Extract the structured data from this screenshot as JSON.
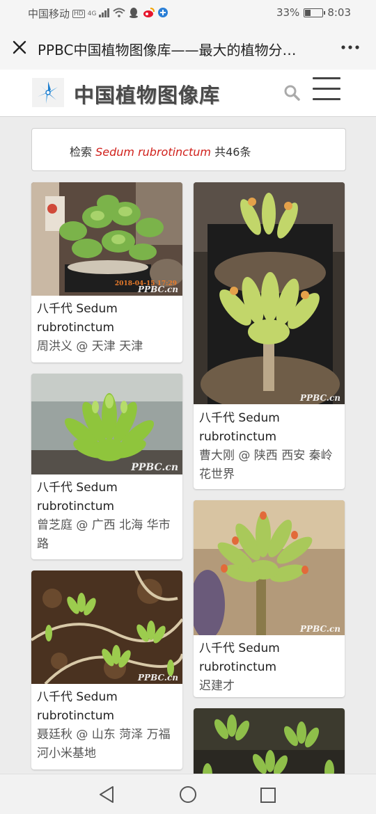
{
  "status_bar": {
    "carrier": "中国移动",
    "hd_badge": "HD",
    "network": "4G",
    "battery_percent": "33%",
    "battery_level": 0.33,
    "time": "8:03"
  },
  "title_bar": {
    "title": "PPBC中国植物图像库——最大的植物分…",
    "close_icon": "close-icon",
    "more_icon": "more-icon"
  },
  "site_header": {
    "logo_text": "中国植物图像库",
    "search_icon": "search-icon",
    "menu_icon": "hamburger-menu-icon"
  },
  "search_result": {
    "prefix": "检索",
    "keyword": "Sedum rubrotinctum",
    "suffix": "共46条"
  },
  "cards": [
    {
      "name": "八千代 Sedum rubrotinctum",
      "author": "周洪义",
      "location": "@ 天津 天津",
      "watermark": "PPBC.cn",
      "photo_date": "2018-04-15 17:29"
    },
    {
      "name": "八千代 Sedum rubrotinctum",
      "author": "曹大刚",
      "location": "@ 陕西 西安 秦岭花世界",
      "watermark": "PPBC.cn"
    },
    {
      "name": "八千代 Sedum rubrotinctum",
      "author": "曾芝庭",
      "location": "@ 广西 北海 华市路",
      "watermark": "PPBC.cn"
    },
    {
      "name": "八千代 Sedum rubrotinctum",
      "author": "迟建才",
      "location": "",
      "watermark": "PPBC.cn"
    },
    {
      "name": "八千代 Sedum rubrotinctum",
      "author": "聂廷秋",
      "location": "@ 山东 菏泽 万福河小米基地",
      "watermark": "PPBC.cn"
    }
  ],
  "colors": {
    "keyword": "#d0201b",
    "background": "#ececec"
  }
}
